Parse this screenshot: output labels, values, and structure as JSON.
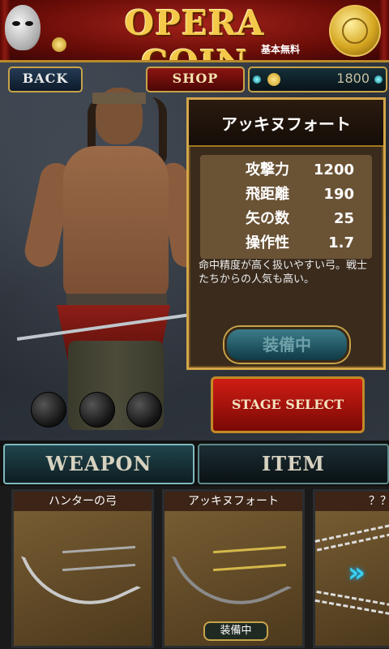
{
  "banner": {
    "title": "OPERA COIN",
    "subtitle": "基本無料"
  },
  "nav": {
    "back_label": "BACK",
    "shop_label": "SHOP",
    "coin_count": "1800"
  },
  "weapon_detail": {
    "name": "アッキヌフォート",
    "stats": [
      {
        "label": "攻撃力",
        "value": "1200"
      },
      {
        "label": "飛距離",
        "value": "190"
      },
      {
        "label": "矢の数",
        "value": "25"
      },
      {
        "label": "操作性",
        "value": "1.7"
      }
    ],
    "description": "命中精度が高く扱いやすい弓。戦士たちからの人気も高い。",
    "equipped_label": "装備中"
  },
  "stage_select_label": "STAGE SELECT",
  "tabs": {
    "weapon": "WEAPON",
    "item": "ITEM"
  },
  "weapon_list": [
    {
      "name": "ハンターの弓",
      "tag": ""
    },
    {
      "name": "アッキヌフォート",
      "tag": "装備中"
    },
    {
      "name": "？？",
      "tag": ""
    }
  ],
  "colors": {
    "banner_red": "#8d1a12",
    "gold": "#d4a64a",
    "teal_button": "#3c7c8a",
    "stage_select_red": "#d01d14"
  }
}
